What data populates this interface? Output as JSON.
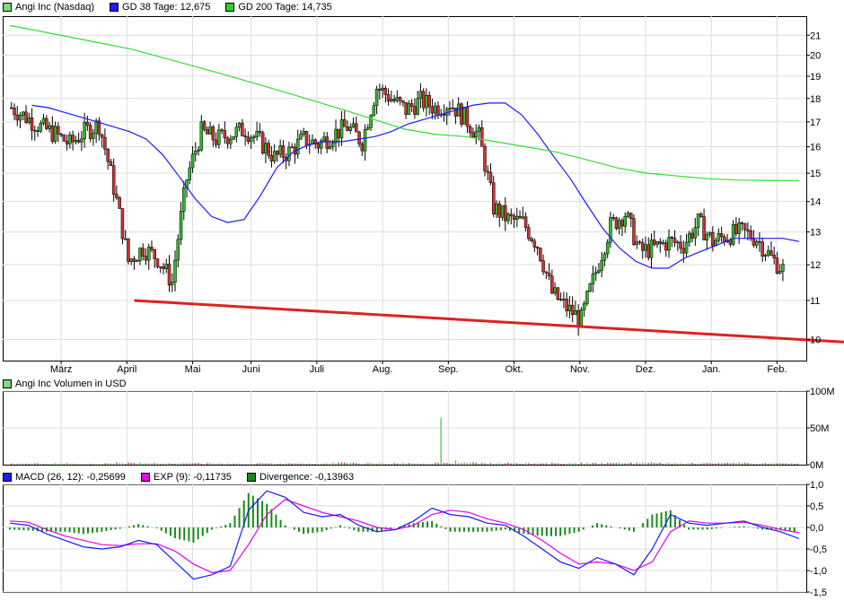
{
  "price_panel": {
    "legend": [
      {
        "label": "Angi Inc (Nasdaq)",
        "color": "#7fd87f"
      },
      {
        "label": "GD 38 Tage: 12,675",
        "color": "#1a1aff"
      },
      {
        "label": "GD 200 Tage: 14,735",
        "color": "#33cc33"
      }
    ]
  },
  "volume_panel": {
    "legend": [
      {
        "label": "Angi Inc Volumen in USD",
        "color": "#7fd87f"
      }
    ]
  },
  "macd_panel": {
    "legend": [
      {
        "label": "MACD (26, 12): -0,25699",
        "color": "#1a1aff"
      },
      {
        "label": "EXP (9): -0,11735",
        "color": "#e600e6"
      },
      {
        "label": "Divergence: -0,13963",
        "color": "#1a8a1a"
      }
    ]
  },
  "colors": {
    "candle_up": "#2eb82e",
    "candle_down": "#cc3333",
    "gd38": "#1a1aff",
    "gd200": "#33dd33",
    "trendline": "#dd2222",
    "macd": "#1a1aff",
    "signal": "#e600e6",
    "divergence": "#1a8a1a",
    "vol_up": "#66cc66",
    "vol_down": "#cc5555",
    "grid": "#dddddd"
  },
  "chart_data": [
    {
      "type": "candlestick",
      "title": "Angi Inc (Nasdaq)",
      "y_scale": "log",
      "ylim": [
        9.5,
        22
      ],
      "yticks": [
        10,
        11,
        12,
        13,
        14,
        15,
        16,
        17,
        18,
        19,
        20,
        21
      ],
      "ytick_labels": [
        "10",
        "11",
        "12",
        "13",
        "14",
        "15",
        "16",
        "17",
        "18",
        "19",
        "20",
        "21"
      ],
      "x_ticks": [
        {
          "label": "März",
          "week": 9.5
        },
        {
          "label": "April",
          "week": 14
        },
        {
          "label": "Mai",
          "week": 18.5
        },
        {
          "label": "Juni",
          "week": 22.5
        },
        {
          "label": "Juli",
          "week": 27
        },
        {
          "label": "Aug.",
          "week": 31.5
        },
        {
          "label": "Sep.",
          "week": 36
        },
        {
          "label": "Okt.",
          "week": 40.5
        },
        {
          "label": "Nov.",
          "week": 45
        },
        {
          "label": "Dez.",
          "week": 49.5
        },
        {
          "label": "Jan.",
          "week": 54
        },
        {
          "label": "Feb.",
          "week": 58.5
        }
      ],
      "x_range_weeks": [
        5.5,
        60.5
      ],
      "weekly_close": [
        17.6,
        17.2,
        16.8,
        16.5,
        16.1,
        16.6,
        16.9,
        14.5,
        12.1,
        12.5,
        12.2,
        11.5,
        14.8,
        16.6,
        16.3,
        16.5,
        16.7,
        16.2,
        15.6,
        15.8,
        16.3,
        16.1,
        16.5,
        16.8,
        16.2,
        18.5,
        18.0,
        17.5,
        17.9,
        17.6,
        17.8,
        17.2,
        16.4,
        13.8,
        13.4,
        13.3,
        12.6,
        11.2,
        10.8,
        10.5,
        11.8,
        13.2,
        13.6,
        12.4,
        12.5,
        12.7,
        12.6,
        13.3,
        12.7,
        12.9,
        13.0,
        12.8,
        12.2,
        11.8
      ],
      "series": [
        {
          "name": "GD 38 Tage",
          "last": 12.675,
          "values": [
            17.7,
            17.6,
            17.4,
            17.2,
            17.0,
            16.8,
            16.6,
            16.3,
            15.7,
            14.9,
            14.1,
            13.5,
            13.3,
            13.4,
            14.2,
            15.2,
            15.8,
            16.1,
            16.2,
            16.2,
            16.3,
            16.4,
            16.6,
            16.9,
            17.1,
            17.3,
            17.5,
            17.7,
            17.8,
            17.8,
            17.3,
            16.5,
            15.6,
            14.8,
            13.9,
            13.1,
            12.5,
            12.1,
            11.9,
            11.9,
            12.2,
            12.4,
            12.6,
            12.8,
            12.8,
            12.8,
            12.8,
            12.7
          ]
        },
        {
          "name": "GD 200 Tage",
          "last": 14.735,
          "values": [
            21.5,
            21.2,
            20.9,
            20.6,
            20.3,
            19.9,
            19.5,
            19.1,
            18.7,
            18.3,
            17.9,
            17.5,
            17.1,
            16.7,
            16.5,
            16.4,
            16.2,
            16.0,
            15.8,
            15.5,
            15.2,
            15.0,
            14.9,
            14.8,
            14.75,
            14.74,
            14.735
          ]
        }
      ],
      "trendline": {
        "from": {
          "week": 14.5,
          "value": 11.0
        },
        "to": {
          "week": 65,
          "value": 9.9
        }
      }
    },
    {
      "type": "bar",
      "title": "Angi Inc Volumen in USD",
      "ylim": [
        0,
        100
      ],
      "yticks": [
        0,
        50,
        100
      ],
      "ytick_labels": [
        "0M",
        "50M",
        "100M"
      ],
      "values_million_usd": [
        1.5,
        1.8,
        1.2,
        2.0,
        1.6,
        1.4,
        1.9,
        2.2,
        2.5,
        1.8,
        1.7,
        1.6,
        2.0,
        1.9,
        1.5,
        1.6,
        1.4,
        1.8,
        1.7,
        2.1,
        1.6,
        1.5,
        2.8,
        3.0,
        2.2,
        1.9,
        1.8,
        2.0,
        1.7,
        64.0,
        6.0,
        2.5,
        2.0,
        2.2,
        2.4,
        2.1,
        1.8,
        2.0,
        1.9,
        2.3,
        2.1,
        2.5,
        3.0,
        2.6,
        2.8,
        2.4,
        2.2,
        2.0,
        2.4,
        2.6,
        2.3,
        2.1,
        2.0,
        2.2
      ],
      "peak": {
        "week": 41.5,
        "value": 64
      }
    },
    {
      "type": "line",
      "title": "MACD",
      "ylim": [
        -1.5,
        1.0
      ],
      "yticks": [
        -1.5,
        -1.0,
        -0.5,
        0.0,
        0.5,
        1.0
      ],
      "ytick_labels": [
        "-1,5",
        "-1,0",
        "-0,5",
        "0,0",
        "0,5",
        "1,0"
      ],
      "series": [
        {
          "name": "MACD (26, 12)",
          "last": -0.25699,
          "values": [
            0.1,
            0.05,
            -0.15,
            -0.3,
            -0.45,
            -0.5,
            -0.45,
            -0.3,
            -0.4,
            -0.8,
            -1.2,
            -1.1,
            -0.9,
            0.4,
            0.85,
            0.7,
            0.35,
            0.25,
            0.3,
            0.05,
            -0.1,
            -0.05,
            0.15,
            0.45,
            0.3,
            0.25,
            0.1,
            0.05,
            -0.2,
            -0.5,
            -0.8,
            -0.95,
            -0.7,
            -0.85,
            -1.1,
            -0.5,
            0.3,
            0.1,
            0.05,
            0.1,
            0.15,
            0.0,
            -0.1,
            -0.26
          ]
        },
        {
          "name": "EXP (9)",
          "last": -0.11735,
          "values": [
            0.15,
            0.12,
            -0.05,
            -0.2,
            -0.3,
            -0.4,
            -0.42,
            -0.38,
            -0.38,
            -0.55,
            -0.85,
            -1.05,
            -1.0,
            -0.4,
            0.3,
            0.65,
            0.5,
            0.35,
            0.25,
            0.15,
            0.0,
            -0.05,
            0.05,
            0.3,
            0.4,
            0.35,
            0.2,
            0.1,
            -0.05,
            -0.3,
            -0.6,
            -0.85,
            -0.8,
            -0.85,
            -1.0,
            -0.8,
            -0.1,
            0.15,
            0.1,
            0.1,
            0.12,
            0.05,
            -0.05,
            -0.12
          ]
        },
        {
          "name": "Divergence",
          "last": -0.13963,
          "type": "bar",
          "values": [
            -0.05,
            -0.07,
            -0.1,
            -0.1,
            -0.15,
            -0.1,
            -0.03,
            0.08,
            -0.02,
            -0.25,
            -0.35,
            -0.05,
            0.1,
            0.8,
            0.55,
            0.05,
            -0.15,
            -0.1,
            0.05,
            -0.1,
            -0.1,
            0.0,
            0.1,
            0.15,
            -0.1,
            -0.1,
            -0.1,
            -0.05,
            -0.15,
            -0.2,
            -0.2,
            -0.1,
            0.1,
            0.0,
            -0.1,
            0.3,
            0.4,
            -0.05,
            -0.05,
            0.0,
            0.03,
            -0.05,
            -0.05,
            -0.14
          ]
        }
      ]
    }
  ]
}
